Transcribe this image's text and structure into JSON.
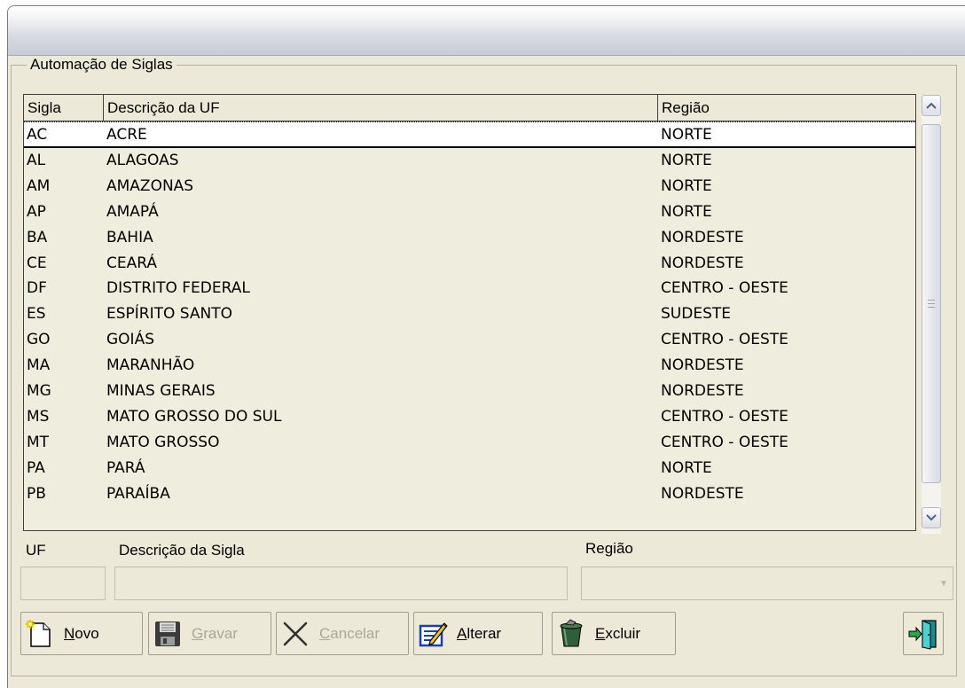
{
  "window": {
    "title": ""
  },
  "group": {
    "legend": "Automação de Siglas"
  },
  "grid": {
    "columns": [
      "Sigla",
      "Descrição da UF",
      "Região"
    ],
    "rows": [
      [
        "AC",
        "ACRE",
        "NORTE"
      ],
      [
        "AL",
        "ALAGOAS",
        "NORTE"
      ],
      [
        "AM",
        "AMAZONAS",
        "NORTE"
      ],
      [
        "AP",
        "AMAPÁ",
        "NORTE"
      ],
      [
        "BA",
        "BAHIA",
        "NORDESTE"
      ],
      [
        "CE",
        "CEARÁ",
        "NORDESTE"
      ],
      [
        "DF",
        "DISTRITO FEDERAL",
        "CENTRO - OESTE"
      ],
      [
        "ES",
        "ESPÍRITO SANTO",
        "SUDESTE"
      ],
      [
        "GO",
        "GOIÁS",
        "CENTRO - OESTE"
      ],
      [
        "MA",
        "MARANHÃO",
        "NORDESTE"
      ],
      [
        "MG",
        "MINAS GERAIS",
        "NORDESTE"
      ],
      [
        "MS",
        "MATO GROSSO DO SUL",
        "CENTRO - OESTE"
      ],
      [
        "MT",
        "MATO GROSSO",
        "CENTRO - OESTE"
      ],
      [
        "PA",
        "PARÁ",
        "NORTE"
      ],
      [
        "PB",
        "PARAÍBA",
        "NORDESTE"
      ]
    ]
  },
  "form": {
    "uf_label": "UF",
    "uf_value": "",
    "desc_label": "Descrição da Sigla",
    "desc_value": "",
    "regiao_label": "Região",
    "regiao_value": ""
  },
  "toolbar": {
    "novo": {
      "accel": "N",
      "rest": "ovo"
    },
    "gravar": {
      "accel": "G",
      "rest": "ravar"
    },
    "cancelar": {
      "accel": "C",
      "rest": "ancelar"
    },
    "alterar": {
      "accel": "A",
      "rest": "lterar"
    },
    "excluir": {
      "accel": "E",
      "rest": "xcluir"
    }
  },
  "icons": {
    "novo": "new-document-icon",
    "gravar": "floppy-disk-icon",
    "cancelar": "cancel-x-icon",
    "alterar": "edit-pencil-icon",
    "excluir": "trash-can-icon",
    "sair": "exit-door-icon",
    "scroll_up": "chevron-up-icon",
    "scroll_down": "chevron-down-icon",
    "combo": "dropdown-arrow-icon"
  },
  "colors": {
    "window_bg": "#ece9d8",
    "grid_bg": "#efedde",
    "selected_row": "#ffffff",
    "disabled_text": "#aca899"
  }
}
